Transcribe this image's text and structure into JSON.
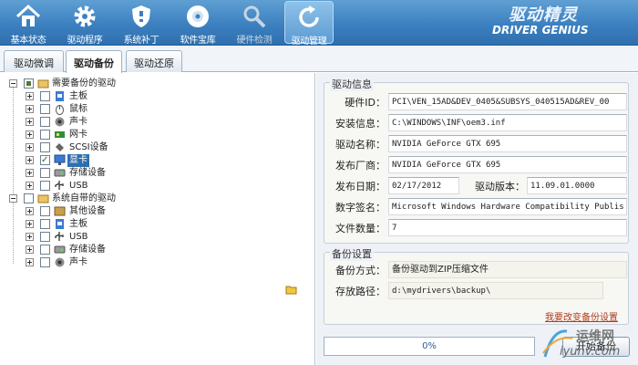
{
  "toolbar": {
    "items": [
      {
        "label": "基本状态",
        "icon": "home-icon"
      },
      {
        "label": "驱动程序",
        "icon": "gear-icon"
      },
      {
        "label": "系统补丁",
        "icon": "shield-icon"
      },
      {
        "label": "软件宝库",
        "icon": "disc-icon"
      },
      {
        "label": "硬件检测",
        "icon": "magnifier-icon"
      },
      {
        "label": "驱动管理",
        "icon": "refresh-icon"
      }
    ],
    "active_index": 5,
    "disabled_index": 4
  },
  "logo": {
    "text": "驱动精灵",
    "subtitle": "DRIVER GENIUS"
  },
  "tabs": [
    {
      "label": "驱动微调"
    },
    {
      "label": "驱动备份"
    },
    {
      "label": "驱动还原"
    }
  ],
  "active_tab": 1,
  "tree": {
    "group1": {
      "label": "需要备份的驱动",
      "items": [
        {
          "label": "主板",
          "icon": "motherboard-icon"
        },
        {
          "label": "鼠标",
          "icon": "mouse-icon"
        },
        {
          "label": "声卡",
          "icon": "speaker-icon"
        },
        {
          "label": "网卡",
          "icon": "network-card-icon"
        },
        {
          "label": "SCSI设备",
          "icon": "scsi-icon"
        },
        {
          "label": "显卡",
          "icon": "monitor-icon",
          "selected": true,
          "checked": true
        },
        {
          "label": "存储设备",
          "icon": "disk-icon"
        },
        {
          "label": "USB",
          "icon": "usb-icon"
        }
      ]
    },
    "group2": {
      "label": "系统自带的驱动",
      "items": [
        {
          "label": "其他设备",
          "icon": "device-icon"
        },
        {
          "label": "主板",
          "icon": "motherboard-icon"
        },
        {
          "label": "USB",
          "icon": "usb-icon"
        },
        {
          "label": "存储设备",
          "icon": "disk-icon"
        },
        {
          "label": "声卡",
          "icon": "speaker-icon"
        }
      ]
    }
  },
  "driver_info": {
    "title": "驱动信息",
    "hardware_id_label": "硬件ID：",
    "hardware_id": "PCI\\VEN_15AD&DEV_0405&SUBSYS_040515AD&REV_00",
    "install_info_label": "安装信息：",
    "install_info": "C:\\WINDOWS\\INF\\oem3.inf",
    "name_label": "驱动名称：",
    "name": "NVIDIA GeForce GTX 695",
    "vendor_label": "发布厂商：",
    "vendor": "NVIDIA GeForce GTX 695",
    "date_label": "发布日期：",
    "date": "02/17/2012",
    "version_label": "驱动版本：",
    "version": "11.09.01.0000",
    "signature_label": "数字签名：",
    "signature": "Microsoft Windows Hardware Compatibility Publis",
    "file_count_label": "文件数量：",
    "file_count": "7"
  },
  "backup_settings": {
    "title": "备份设置",
    "method_label": "备份方式：",
    "method": "备份驱动到ZIP压缩文件",
    "path_label": "存放路径：",
    "path": "d:\\mydrivers\\backup\\",
    "change_link": "我要改变备份设置"
  },
  "progress": {
    "text": "0%",
    "value": 0
  },
  "start_button": "开始备份",
  "watermark": {
    "line1": "运维网",
    "line2": "iyunv.com"
  },
  "colors": {
    "toolbar": "#3c80c0",
    "selection": "#2f6fae",
    "link": "#b03a1a"
  }
}
